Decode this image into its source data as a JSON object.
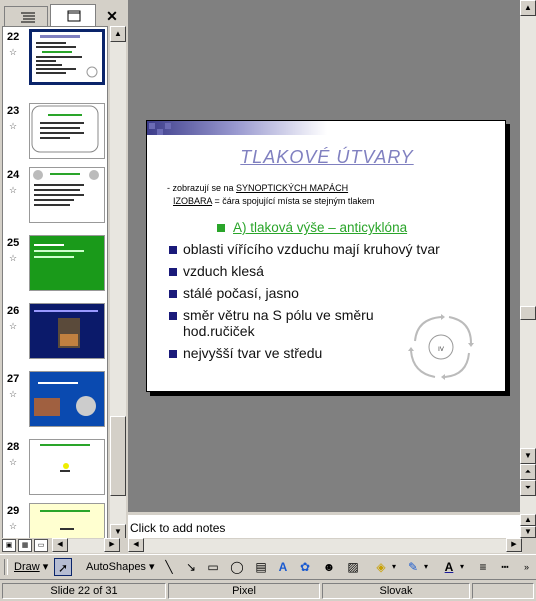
{
  "thumbnails": [
    {
      "num": "22",
      "style": "white-list"
    },
    {
      "num": "23",
      "style": "white-frame"
    },
    {
      "num": "24",
      "style": "white-circles"
    },
    {
      "num": "25",
      "style": "green"
    },
    {
      "num": "26",
      "style": "navy"
    },
    {
      "num": "27",
      "style": "blue"
    },
    {
      "num": "28",
      "style": "white-map"
    },
    {
      "num": "29",
      "style": "yellow"
    }
  ],
  "slide": {
    "title": "TLAKOVÉ ÚTVARY",
    "line1_prefix": "- zobrazují se na ",
    "line1_link": "SYNOPTICKÝCH MAPÁCH",
    "line2_link": "IZOBARA",
    "line2_rest": " = čára spojující místa se stejným tlakem",
    "subheading": "A) tlaková výše – anticyklóna",
    "bullets": [
      "oblasti vířícího vzduchu mají kruhový tvar",
      "vzduch klesá",
      "stálé počasí, jasno",
      "směr větru na S pólu ve směru",
      "nejvyšší tvar ve středu"
    ],
    "bullet4_cont": "hod.ručiček",
    "cyclone_label": "IV"
  },
  "notes": {
    "placeholder": "Click to add notes"
  },
  "draw_toolbar": {
    "draw_label": "Draw",
    "autoshapes_label": "AutoShapes"
  },
  "status": {
    "slide": "Slide 22 of 31",
    "design": "Pixel",
    "language": "Slovak"
  },
  "colors": {
    "slide_title": "#8080c0",
    "subheading": "#2aa52a",
    "bullet": "#1a1a7a",
    "selection": "#0a246a"
  }
}
